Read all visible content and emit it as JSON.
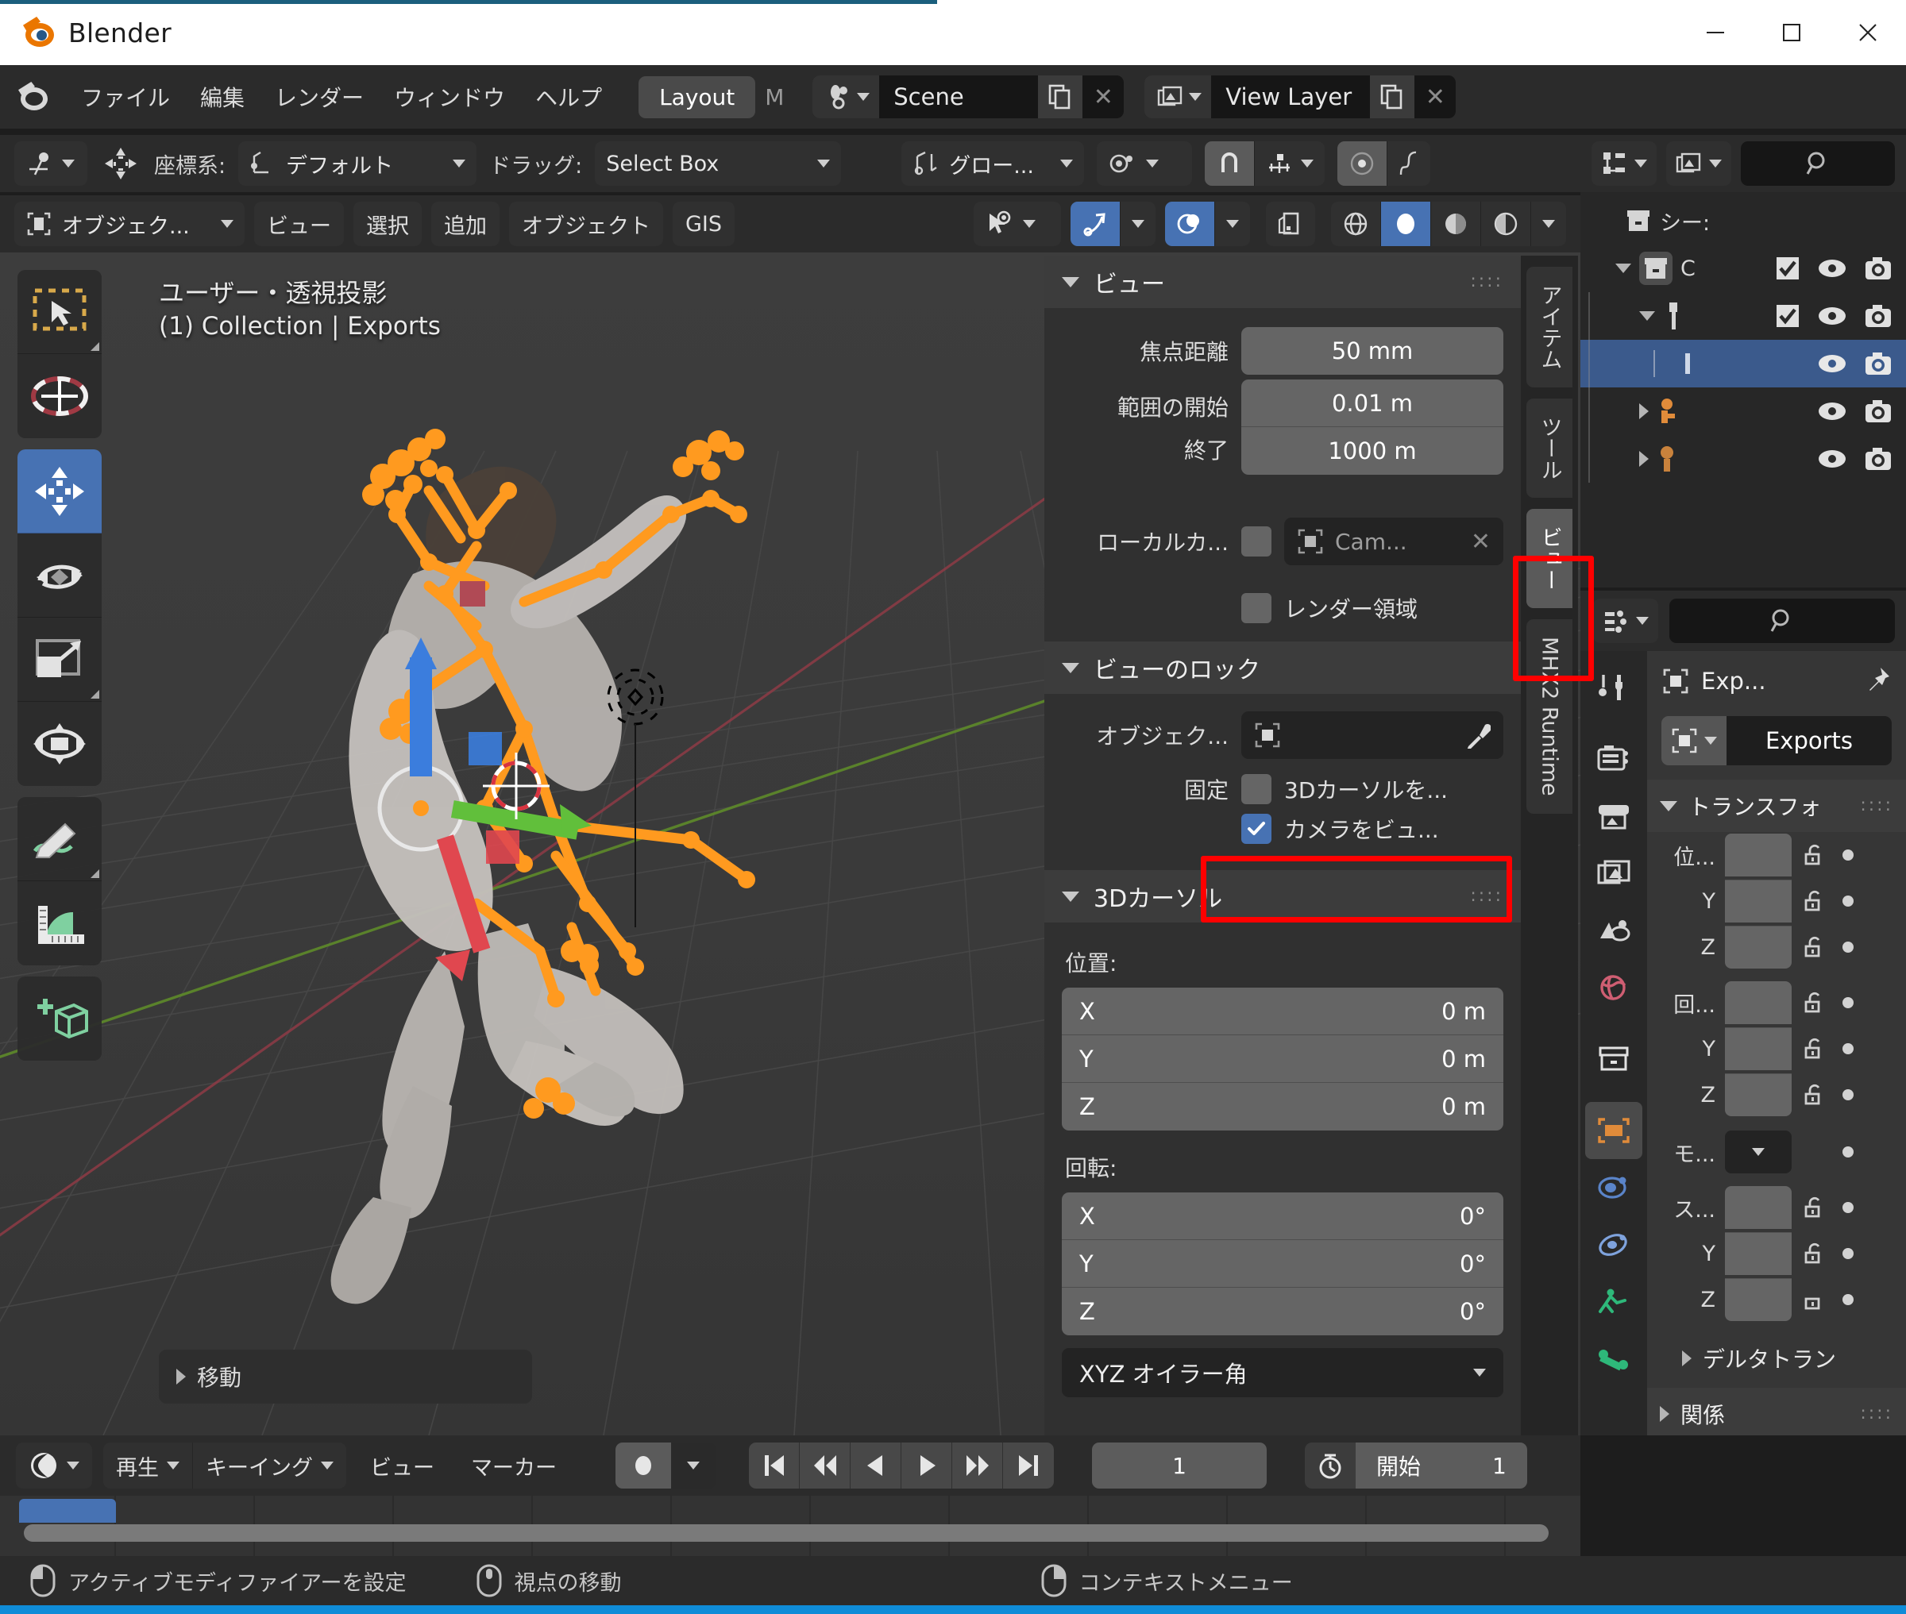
{
  "window": {
    "title": "Blender",
    "minimize": "─",
    "maximize": "☐",
    "close": "✕"
  },
  "topbar": {
    "menus": [
      "ファイル",
      "編集",
      "レンダー",
      "ウィンドウ",
      "ヘルプ"
    ],
    "workspaces": [
      {
        "label": "Layout",
        "active": true
      },
      {
        "label": "M",
        "active": false
      }
    ],
    "scene": {
      "name": "Scene",
      "new_label": "",
      "delete_label": "✕"
    },
    "view_layer": {
      "name": "View Layer",
      "new_label": "",
      "delete_label": "✕"
    }
  },
  "viewport_header_row1": {
    "transform_orientation_label": "座標系:",
    "orientation_value": "デフォルト",
    "drag_label": "ドラッグ:",
    "drag_value": "Select Box",
    "snap_value": "グロー...",
    "proportional_icons": [
      "proportional-edit-icon",
      "falloff-icon",
      "snap-magnet-icon"
    ]
  },
  "viewport_header_row2": {
    "mode": "オブジェク...",
    "menus": [
      "ビュー",
      "選択",
      "追加",
      "オブジェクト",
      "GIS"
    ],
    "shading_modes": [
      "wireframe",
      "solid",
      "material-preview",
      "rendered"
    ],
    "active_shading": "solid"
  },
  "viewport": {
    "overlay_line1": "ユーザー・透視投影",
    "overlay_line2": "(1) Collection | Exports",
    "gizmo_axes": [
      "Z",
      "Y",
      "X"
    ],
    "operator_panel": "移動",
    "tools": [
      "tweak-select-box-tool",
      "cursor-tool",
      "move-tool",
      "rotate-tool",
      "scale-tool",
      "transform-tool",
      "annotate-tool",
      "measure-tool",
      "add-cube-tool"
    ],
    "active_tool": "move-tool",
    "nav_buttons": [
      "zoom-icon",
      "pan-hand-icon",
      "camera-view-icon",
      "perspective-ortho-icon"
    ]
  },
  "sidebar": {
    "tabs": [
      {
        "label": "アイテム",
        "active": false
      },
      {
        "label": "ツール",
        "active": false
      },
      {
        "label": "ビュー",
        "active": true
      },
      {
        "label": "MHX2 Runtime",
        "active": false
      }
    ],
    "view_panel": {
      "title": "ビュー",
      "focal_label": "焦点距離",
      "focal_value": "50 mm",
      "clip_start_label": "範囲の開始",
      "clip_start_value": "0.01 m",
      "clip_end_label": "終了",
      "clip_end_value": "1000 m",
      "local_camera_label": "ローカルカ...",
      "local_camera_checked": false,
      "local_camera_object": "Cam...",
      "render_region_label": "レンダー領域",
      "render_region_checked": false
    },
    "lock_panel": {
      "title": "ビューのロック",
      "object_label": "オブジェク...",
      "object_value": "",
      "fixed_label": "固定",
      "cursor_lock_label": "3Dカーソルを...",
      "cursor_lock_checked": false,
      "camera_to_view_label": "カメラをビュ...",
      "camera_to_view_checked": true
    },
    "cursor_panel": {
      "title": "3Dカーソル",
      "location_label": "位置:",
      "location": [
        {
          "axis": "X",
          "value": "0 m"
        },
        {
          "axis": "Y",
          "value": "0 m"
        },
        {
          "axis": "Z",
          "value": "0 m"
        }
      ],
      "rotation_label": "回転:",
      "rotation": [
        {
          "axis": "X",
          "value": "0°"
        },
        {
          "axis": "Y",
          "value": "0°"
        },
        {
          "axis": "Z",
          "value": "0°"
        }
      ],
      "rotation_mode": "XYZ オイラー角"
    }
  },
  "outliner": {
    "header_search_placeholder": "",
    "scene_label": "シー:",
    "rows": [
      {
        "name": "C",
        "depth": 0,
        "expand": "down",
        "icon": "collection-icon",
        "checkbox": true,
        "eye": true,
        "camera": true,
        "selected": false
      },
      {
        "name": "",
        "depth": 1,
        "expand": "down",
        "icon": "object-data-icon",
        "checkbox": true,
        "eye": true,
        "camera": true,
        "selected": false
      },
      {
        "name": "",
        "depth": 2,
        "expand": "none",
        "icon": "mesh-data-icon",
        "checkbox": false,
        "eye": true,
        "camera": true,
        "selected": true
      },
      {
        "name": "",
        "depth": 1,
        "expand": "right",
        "icon": "armature-icon",
        "checkbox": false,
        "eye": true,
        "camera": true,
        "selected": false
      },
      {
        "name": "",
        "depth": 1,
        "expand": "right",
        "icon": "armature-icon",
        "checkbox": false,
        "eye": true,
        "camera": true,
        "selected": false
      }
    ]
  },
  "properties": {
    "breadcrumb_object": "Exp...",
    "id_name": "Exports",
    "transform_panel_title": "トランスフォ",
    "rows": [
      {
        "label": "位...",
        "group": "location",
        "pos": "top"
      },
      {
        "label": "Y",
        "group": "location",
        "pos": "mid"
      },
      {
        "label": "Z",
        "group": "location",
        "pos": "bot"
      },
      {
        "label": "回...",
        "group": "rotation",
        "pos": "top"
      },
      {
        "label": "Y",
        "group": "rotation",
        "pos": "mid"
      },
      {
        "label": "Z",
        "group": "rotation",
        "pos": "bot"
      },
      {
        "label": "モ...",
        "group": "mode",
        "pos": "only"
      },
      {
        "label": "ス...",
        "group": "scale",
        "pos": "top"
      },
      {
        "label": "Y",
        "group": "scale",
        "pos": "mid"
      },
      {
        "label": "Z",
        "group": "scale",
        "pos": "bot"
      }
    ],
    "delta_transform_label": "デルタトラン",
    "relations_label": "関係",
    "tabs": [
      {
        "name": "tool-icon",
        "active": false
      },
      {
        "name": "render-icon",
        "active": false
      },
      {
        "name": "output-icon",
        "active": false
      },
      {
        "name": "view-layer-icon",
        "active": false
      },
      {
        "name": "scene-icon",
        "active": false
      },
      {
        "name": "world-icon",
        "active": false
      },
      {
        "name": "collection-icon",
        "active": false
      },
      {
        "name": "object-icon",
        "active": true
      },
      {
        "name": "modifier-icon",
        "active": false
      },
      {
        "name": "physics-icon",
        "active": false
      },
      {
        "name": "object-constraint-icon",
        "active": false
      },
      {
        "name": "object-data-icon",
        "active": false
      }
    ]
  },
  "timeline": {
    "editor_type": "timeline-editor-icon",
    "menus": [
      {
        "label": "再生",
        "dropdown": true
      },
      {
        "label": "キーイング",
        "dropdown": true
      },
      {
        "label": "ビュー",
        "dropdown": false
      },
      {
        "label": "マーカー",
        "dropdown": false
      }
    ],
    "auto_key_label": "",
    "playback_buttons": [
      "jump-start",
      "prev-keyframe",
      "play-reverse",
      "play",
      "next-keyframe",
      "jump-end"
    ],
    "current_frame": "1",
    "start_label": "開始",
    "start_value": "1"
  },
  "statusbar": {
    "items": [
      {
        "icon": "mouse-left-icon",
        "text": "アクティブモディファイアーを設定"
      },
      {
        "icon": "mouse-middle-icon",
        "text": "視点の移動"
      },
      {
        "icon": "mouse-right-icon",
        "text": "コンテキストメニュー"
      }
    ]
  },
  "colors": {
    "accent_blue": "#4772b3",
    "highlight_red": "#ff0000",
    "orange": "#ea7600",
    "outliner_select": "#3b5a8c",
    "taskbar_blue": "#0f8cd8"
  }
}
